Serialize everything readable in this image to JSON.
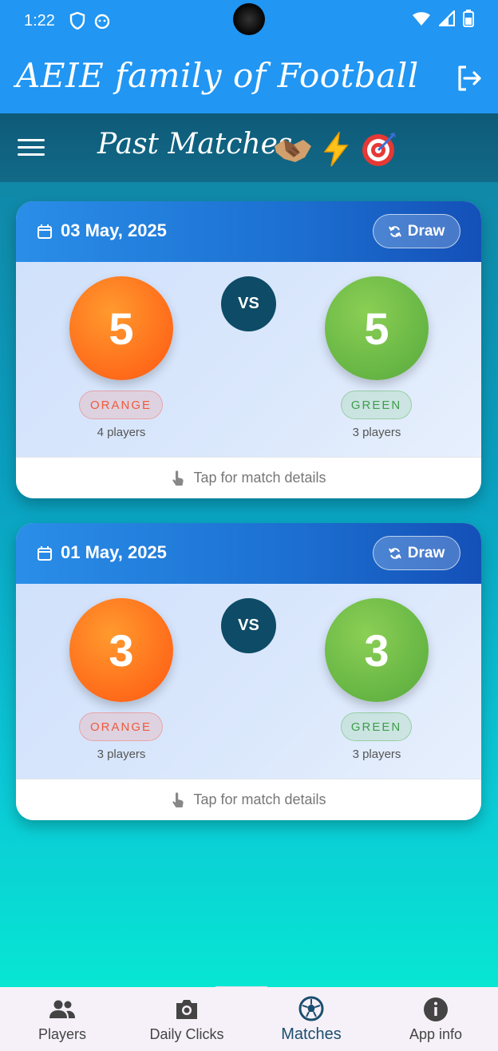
{
  "status": {
    "time": "1:22",
    "icons_left": [
      "shield-icon",
      "cat-icon"
    ],
    "icons_right": [
      "wifi-icon",
      "signal-icon",
      "battery-icon"
    ]
  },
  "appbar": {
    "title": "AEIE family of Football",
    "logout_icon": "logout-icon"
  },
  "subbar": {
    "title": "Past Matches",
    "emojis": [
      "handshake-emoji",
      "lightning-emoji",
      "target-emoji"
    ]
  },
  "matches": [
    {
      "date": "03 May, 2025",
      "result": "Draw",
      "left": {
        "score": "5",
        "team": "ORANGE",
        "players": "4 players"
      },
      "vs": "VS",
      "right": {
        "score": "5",
        "team": "GREEN",
        "players": "3 players"
      },
      "footer": "Tap for match details"
    },
    {
      "date": "01 May, 2025",
      "result": "Draw",
      "left": {
        "score": "3",
        "team": "ORANGE",
        "players": "3 players"
      },
      "vs": "VS",
      "right": {
        "score": "3",
        "team": "GREEN",
        "players": "3 players"
      },
      "footer": "Tap for match details"
    }
  ],
  "nav": [
    {
      "label": "Players",
      "icon": "people-icon"
    },
    {
      "label": "Daily Clicks",
      "icon": "camera-icon"
    },
    {
      "label": "Matches",
      "icon": "football-icon",
      "active": true
    },
    {
      "label": "App info",
      "icon": "info-icon"
    }
  ],
  "colors": {
    "primary": "#2196f3",
    "orange": "#ff6b1a",
    "green": "#66b544",
    "vs": "#0d4b66"
  }
}
